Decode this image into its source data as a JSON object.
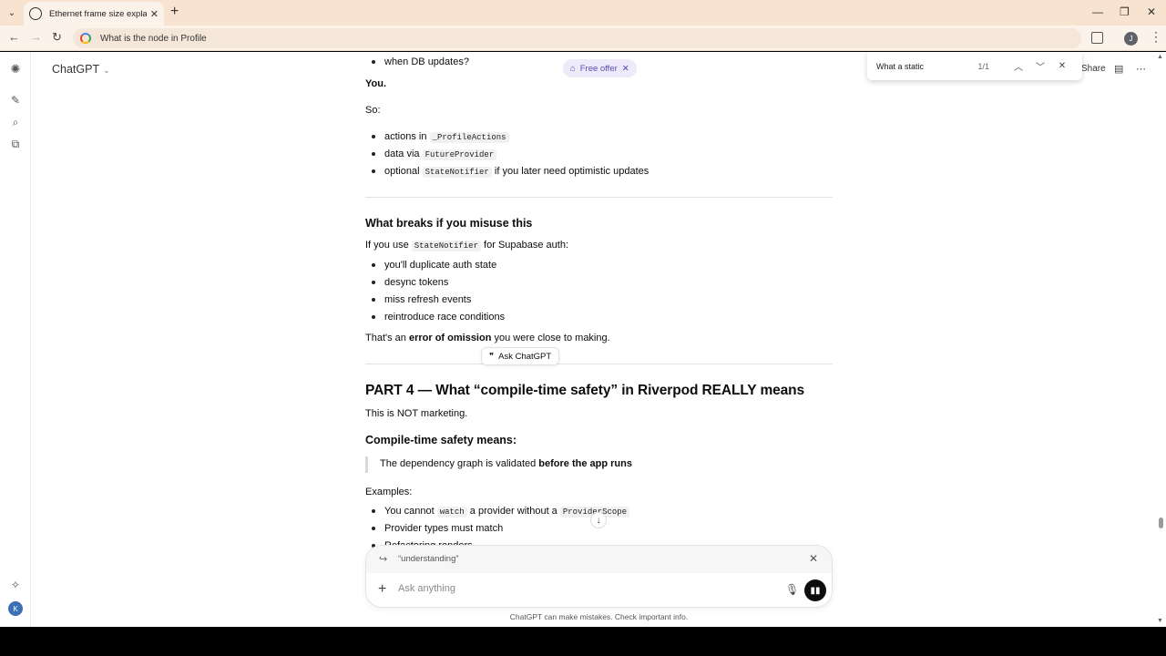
{
  "browser": {
    "tab_title": "Ethernet frame size explanation",
    "address": "What is the node in Profile",
    "profile_initial": "J"
  },
  "app": {
    "model_name": "ChatGPT",
    "free_offer": "Free offer",
    "share_label": "Share",
    "user_initial": "K"
  },
  "find": {
    "query": "What a static",
    "count": "1/1"
  },
  "content": {
    "item_db": "when DB updates?",
    "you": "You.",
    "so": "So:",
    "so_items": [
      {
        "pre": "actions in",
        "code": "_ProfileActions",
        "post": ""
      },
      {
        "pre": "data via",
        "code": "FutureProvider",
        "post": ""
      },
      {
        "pre": "optional",
        "code": "StateNotifier",
        "post": "if you later need optimistic updates"
      }
    ],
    "h_breaks": "What breaks if you misuse this",
    "breaks_intro_pre": "If you use",
    "breaks_intro_code": "StateNotifier",
    "breaks_intro_post": "for Supabase auth:",
    "breaks_items": [
      "you'll duplicate auth state",
      "desync tokens",
      "miss refresh events",
      "reintroduce race conditions"
    ],
    "omission_pre": "That's an",
    "omission_bold": "error of omission",
    "omission_post": "you were close to making.",
    "ask_chatgpt": "Ask ChatGPT",
    "h_part4": "PART 4 — What “compile-time safety” in Riverpod REALLY means",
    "not_marketing": "This is NOT marketing.",
    "h_compile": "Compile-time safety means:",
    "quote_pre": "The dependency graph is validated",
    "quote_bold": "before the app runs",
    "examples": "Examples:",
    "ex1_pre": "You cannot",
    "ex1_code": "watch",
    "ex1_mid": "a provider without a",
    "ex1_code2": "ProviderScope",
    "ex2": "Provider types must match",
    "ex3": "Refactoring renders"
  },
  "composer": {
    "quoted": "“understanding”",
    "placeholder": "Ask anything",
    "disclaimer": "ChatGPT can make mistakes. Check important info."
  }
}
